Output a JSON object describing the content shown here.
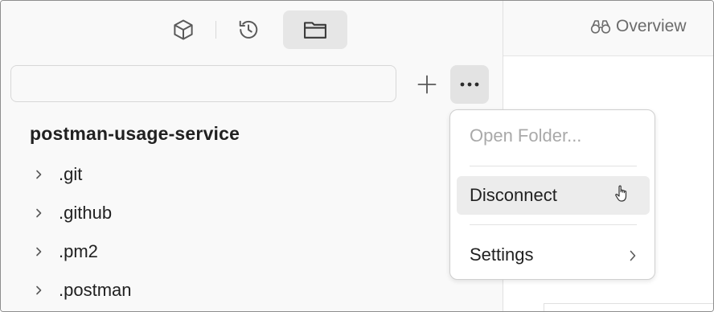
{
  "toolbar": {
    "icons": [
      "cube-icon",
      "history-icon",
      "folder-icon"
    ],
    "active_tab": "folder"
  },
  "search": {
    "value": "",
    "placeholder": ""
  },
  "actions": {
    "add_icon": "plus-icon",
    "more_icon": "more-horizontal-icon"
  },
  "tree": {
    "root": "postman-usage-service",
    "items": [
      {
        "label": ".git"
      },
      {
        "label": ".github"
      },
      {
        "label": ".pm2"
      },
      {
        "label": ".postman"
      }
    ]
  },
  "right_header": {
    "tab_label": "Overview",
    "tab_icon": "binoculars-icon"
  },
  "menu": {
    "items": [
      {
        "label": "Open Folder...",
        "state": "disabled"
      },
      {
        "label": "Disconnect",
        "state": "hover"
      },
      {
        "label": "Settings",
        "state": "normal",
        "submenu": true
      }
    ]
  },
  "colors": {
    "pane_bg": "#f9f9f9",
    "active_tab_bg": "#e6e6e6",
    "menu_hover_bg": "#ececec",
    "disabled_text": "#a9a9a9",
    "text": "#212121"
  }
}
